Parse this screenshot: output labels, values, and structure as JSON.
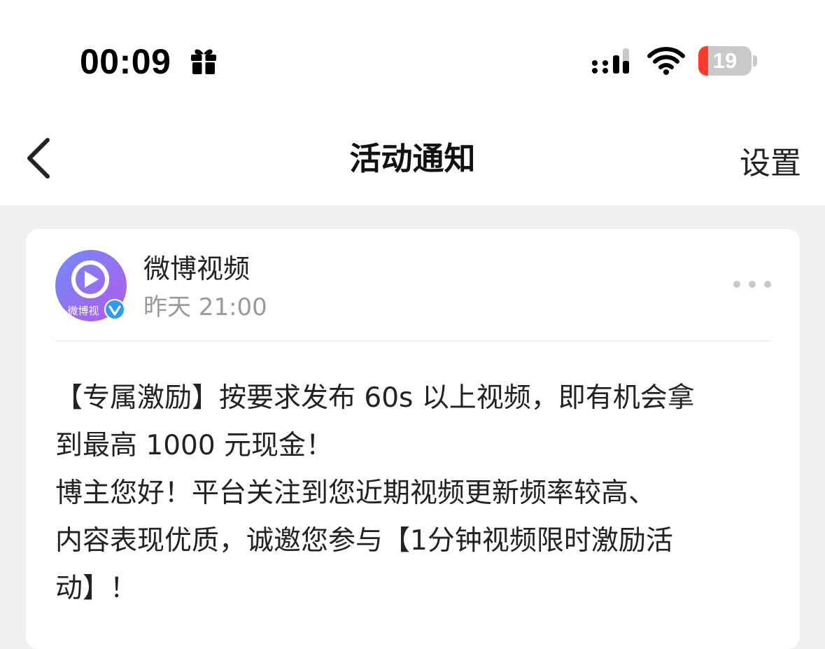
{
  "status_bar": {
    "time": "00:09",
    "battery_level": "19",
    "battery_fraction": 0.19,
    "battery_color": "#ff3b30",
    "icons": [
      "gift-icon",
      "signal-icon",
      "wifi-icon",
      "battery-icon"
    ]
  },
  "nav": {
    "title": "活动通知",
    "settings_label": "设置",
    "back_icon": "chevron-left-icon"
  },
  "notification": {
    "sender_name": "微博视频",
    "sender_time": "昨天 21:00",
    "avatar_label": "微博视",
    "message_lines": [
      "【专属激励】按要求发布 60s 以上视频，即有机会拿",
      "到最高 1000 元现金！",
      "博主您好！平台关注到您近期视频更新频率较高、",
      "内容表现优质，诚邀您参与【1分钟视频限时激励活",
      "动】！"
    ]
  },
  "colors": {
    "background": "#f0f0f0",
    "card": "#ffffff",
    "avatar_ring": "#8a63f0",
    "verified": "#2d9cf0"
  }
}
